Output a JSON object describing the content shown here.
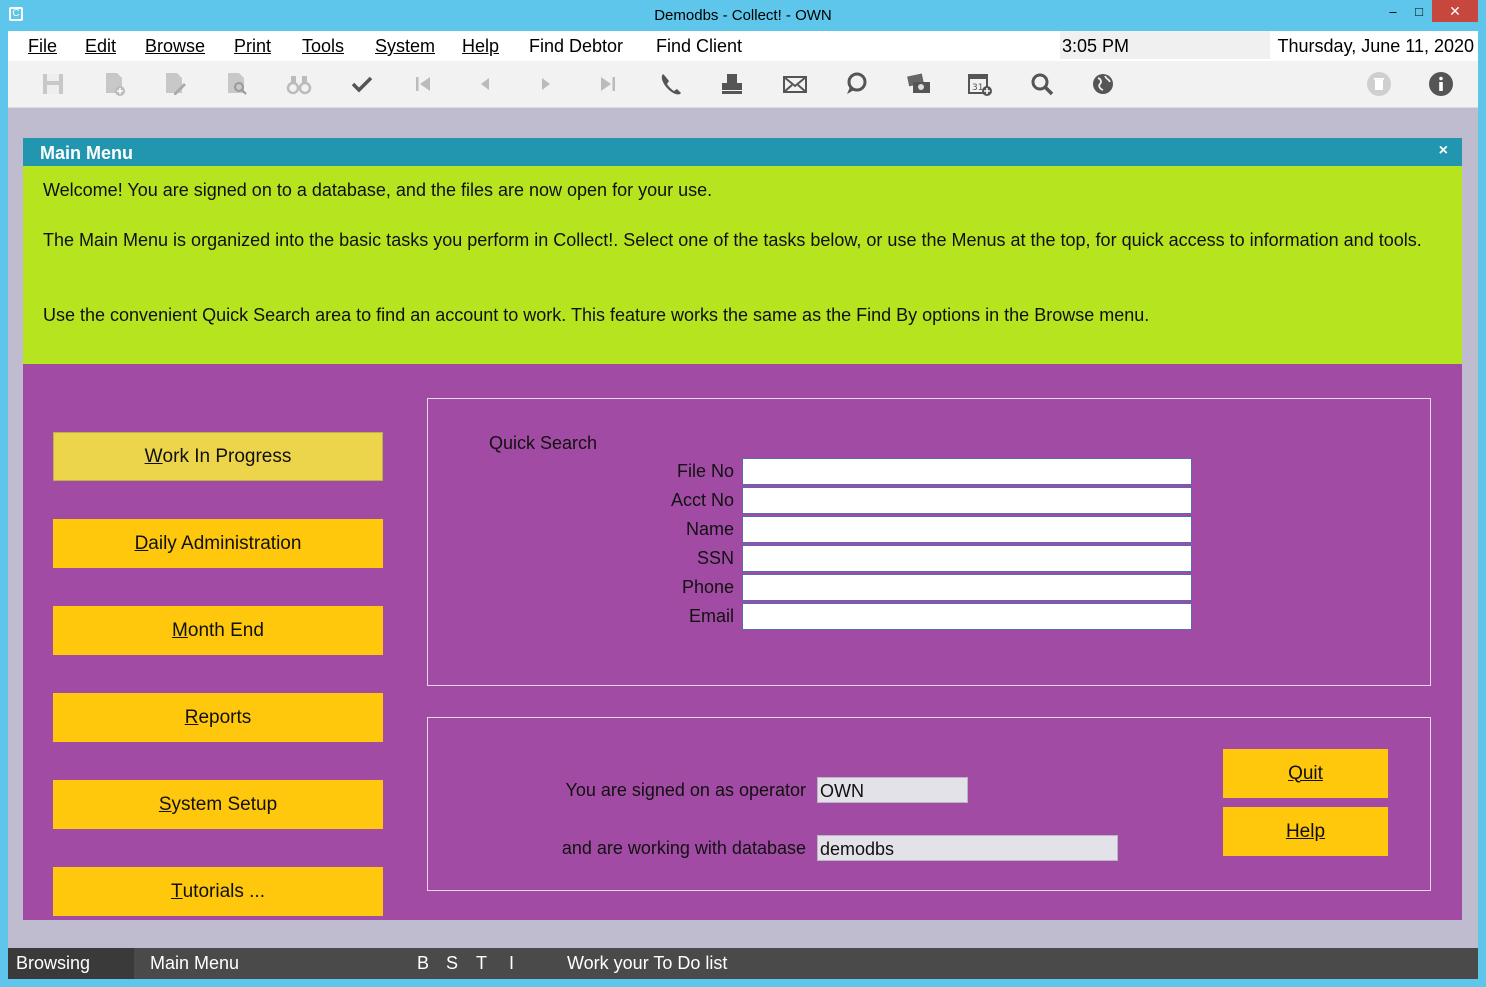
{
  "window": {
    "title": "Demodbs - Collect! - OWN",
    "minimize": "‒",
    "maximize": "□",
    "close": "✕"
  },
  "menubar": {
    "items": [
      "File",
      "Edit",
      "Browse",
      "Print",
      "Tools",
      "System",
      "Help",
      "Find Debtor",
      "Find Client"
    ],
    "time": "3:05 PM",
    "date": "Thursday, June 11, 2020"
  },
  "toolbar": {
    "icons": [
      "save-icon",
      "new-record-icon",
      "edit-record-icon",
      "search-record-icon",
      "binoculars-icon",
      "checkmark-icon",
      "first-record-icon",
      "previous-record-icon",
      "next-record-icon",
      "last-record-icon",
      "phone-icon",
      "printer-icon",
      "email-icon",
      "chat-icon",
      "payment-card-icon",
      "calendar-add-icon",
      "magnifier-icon",
      "globe-icon",
      "trash-icon",
      "info-icon"
    ]
  },
  "panel": {
    "title": "Main Menu",
    "close": "×",
    "welcome": [
      "Welcome! You are signed on to a database, and the files are now open for your use.",
      "The Main Menu is organized into the basic tasks you perform in Collect!. Select one of the tasks below, or use the Menus at the top, for quick access to information and tools.",
      "Use the convenient Quick Search area to find an account to work. This feature works the same as the Find By options in the Browse menu."
    ],
    "nav": [
      {
        "label": "Work In Progress",
        "hot": "W",
        "rest": "ork In Progress"
      },
      {
        "label": "Daily Administration",
        "hot": "D",
        "rest": "aily Administration"
      },
      {
        "label": "Month End",
        "hot": "M",
        "rest": "onth End"
      },
      {
        "label": "Reports",
        "hot": "R",
        "rest": "eports"
      },
      {
        "label": "System Setup",
        "hot": "S",
        "rest": "ystem Setup"
      },
      {
        "label": "Tutorials ...",
        "hot": "T",
        "rest": "utorials ..."
      }
    ],
    "quick_search": {
      "title": "Quick Search",
      "fields": [
        {
          "label": "File No",
          "value": ""
        },
        {
          "label": "Acct No",
          "value": ""
        },
        {
          "label": "Name",
          "value": ""
        },
        {
          "label": "SSN",
          "value": ""
        },
        {
          "label": "Phone",
          "value": ""
        },
        {
          "label": "Email",
          "value": ""
        }
      ]
    },
    "session": {
      "operator_label": "You are signed on as operator",
      "operator_value": "OWN",
      "database_label": "and are working with database",
      "database_value": "demodbs",
      "quit_label": "Quit",
      "help_label": "Help"
    }
  },
  "status": {
    "mode": "Browsing",
    "screen": "Main Menu",
    "flags": [
      "B",
      "S",
      "T",
      "I"
    ],
    "hint": "Work your To Do list"
  },
  "colors": {
    "titlebar": "#5ec6ea",
    "panel_header": "#2196ae",
    "welcome_bg": "#b6e41f",
    "panel_bg": "#a24ba4",
    "button": "#ffc80d",
    "button_active": "#ecd54a",
    "statusbar": "#4a4a4a"
  }
}
